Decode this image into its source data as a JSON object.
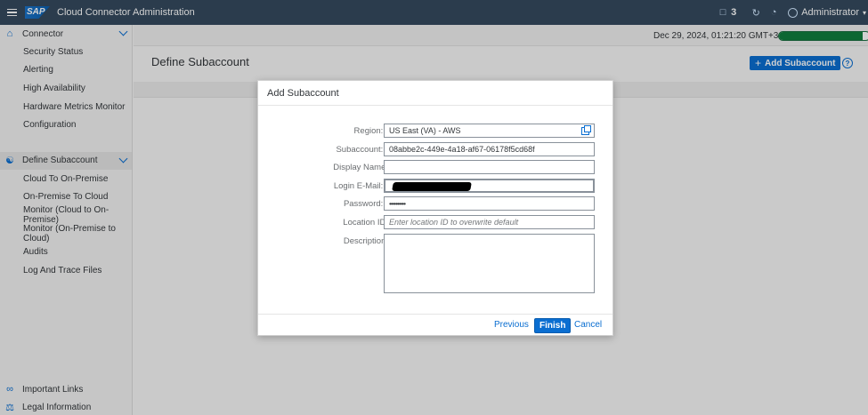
{
  "shell": {
    "title": "Cloud Connector Administration",
    "logo_text": "SAP",
    "notifications_count": "3",
    "user_name": "Administrator"
  },
  "sidebar": {
    "groups": [
      {
        "label": "Connector",
        "icon": "home-icon",
        "items": [
          "Security Status",
          "Alerting",
          "High Availability",
          "Hardware Metrics Monitor",
          "Configuration"
        ]
      },
      {
        "label": "Define Subaccount",
        "icon": "subaccount-icon",
        "items": [
          "Cloud To On-Premise",
          "On-Premise To Cloud",
          "Monitor (Cloud to On-Premise)",
          "Monitor (On-Premise to Cloud)",
          "Audits",
          "Log And Trace Files"
        ]
      }
    ],
    "bottom": [
      {
        "label": "Important Links",
        "icon": "link-icon"
      },
      {
        "label": "Legal Information",
        "icon": "scales-icon"
      }
    ]
  },
  "status": {
    "datetime": "Dec 29, 2024, 01:21:20 GMT+3",
    "progress_fraction": 0.92
  },
  "page": {
    "title": "Define Subaccount",
    "add_button": "Add Subaccount"
  },
  "dialog": {
    "title": "Add Subaccount",
    "fields": {
      "region": {
        "label": "Region:",
        "value": "US East (VA) - AWS"
      },
      "subaccount": {
        "label": "Subaccount:",
        "value": "08abbe2c-449e-4a18-af67-06178f5cd68f"
      },
      "display_name": {
        "label": "Display Name:",
        "value": ""
      },
      "login_email": {
        "label": "Login E-Mail:",
        "value": ""
      },
      "password": {
        "label": "Password:",
        "value": "••••••••••"
      },
      "location_id": {
        "label": "Location ID:",
        "placeholder": "Enter location ID to overwrite default"
      },
      "description": {
        "label": "Description:",
        "value": ""
      }
    },
    "required_marker": "*",
    "buttons": {
      "previous": "Previous",
      "finish": "Finish",
      "cancel": "Cancel"
    }
  },
  "colors": {
    "shell": "#354a5f",
    "accent": "#0a6ed1",
    "required": "#bb0000",
    "progress": "#107e3e"
  }
}
